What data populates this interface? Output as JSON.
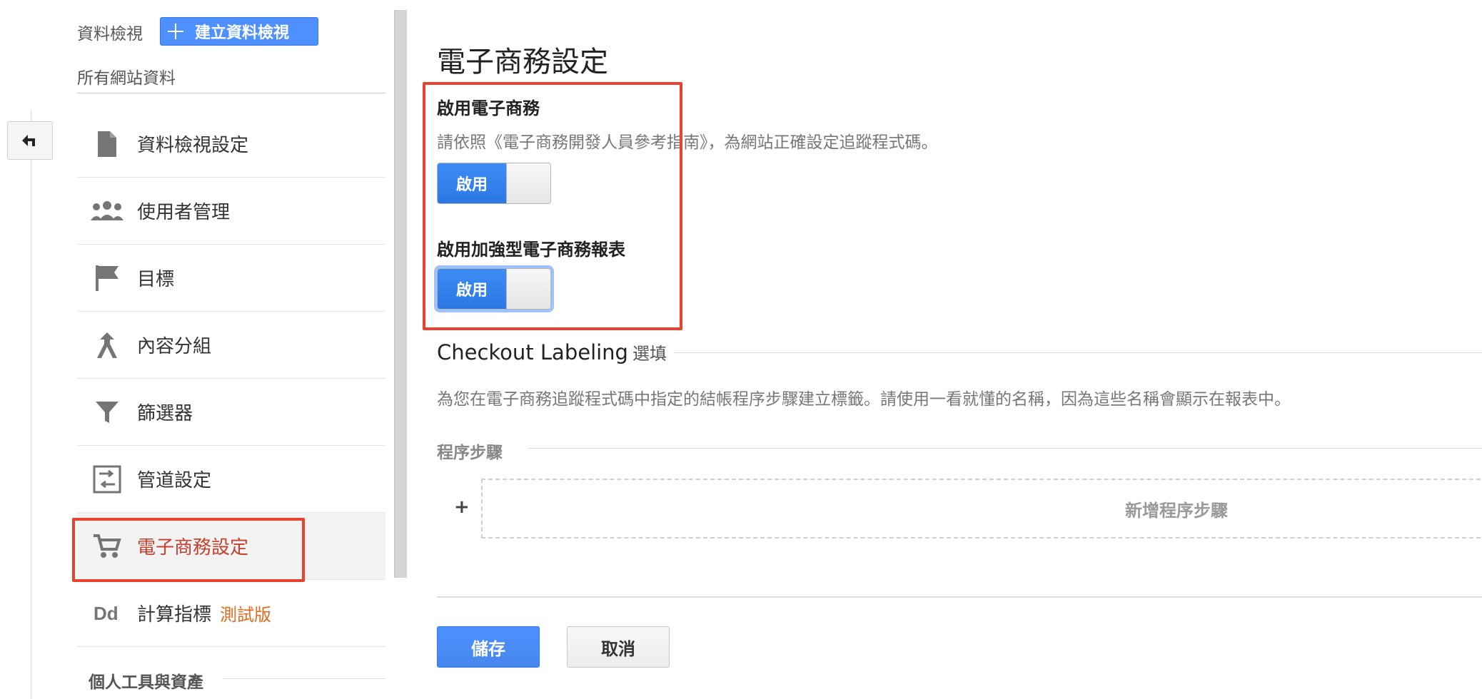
{
  "sidebar": {
    "view_label": "資料檢視",
    "create_view_label": "建立資料檢視",
    "view_name": "所有網站資料",
    "items": [
      {
        "label": "資料檢視設定",
        "icon": "document-icon"
      },
      {
        "label": "使用者管理",
        "icon": "users-icon"
      },
      {
        "label": "目標",
        "icon": "flag-icon"
      },
      {
        "label": "內容分組",
        "icon": "content-grouping-icon"
      },
      {
        "label": "篩選器",
        "icon": "filter-icon"
      },
      {
        "label": "管道設定",
        "icon": "channel-settings-icon"
      },
      {
        "label": "電子商務設定",
        "icon": "cart-icon",
        "active": true
      },
      {
        "label": "計算指標",
        "icon": "calculated-metrics-icon",
        "badge": "測試版"
      }
    ],
    "personal_tools_title": "個人工具與資產"
  },
  "main": {
    "title": "電子商務設定",
    "ecommerce": {
      "title": "啟用電子商務",
      "description": "請依照《電子商務開發人員參考指南》，為網站正確設定追蹤程式碼。",
      "toggle_label": "啟用"
    },
    "enhanced": {
      "title": "啟用加強型電子商務報表",
      "toggle_label": "啟用"
    },
    "checkout": {
      "title": "Checkout Labeling",
      "optional": "選填",
      "description": "為您在電子商務追蹤程式碼中指定的結帳程序步驟建立標籤。請使用一看就懂的名稱，因為這些名稱會顯示在報表中。",
      "steps_title": "程序步驟",
      "add_plus": "+",
      "add_step_label": "新增程序步驟"
    },
    "actions": {
      "save_label": "儲存",
      "cancel_label": "取消"
    }
  },
  "colors": {
    "accent": "#4d90fe",
    "highlight": "#e8432e",
    "active_nav": "#c5402d",
    "beta": "#dd6b20"
  }
}
